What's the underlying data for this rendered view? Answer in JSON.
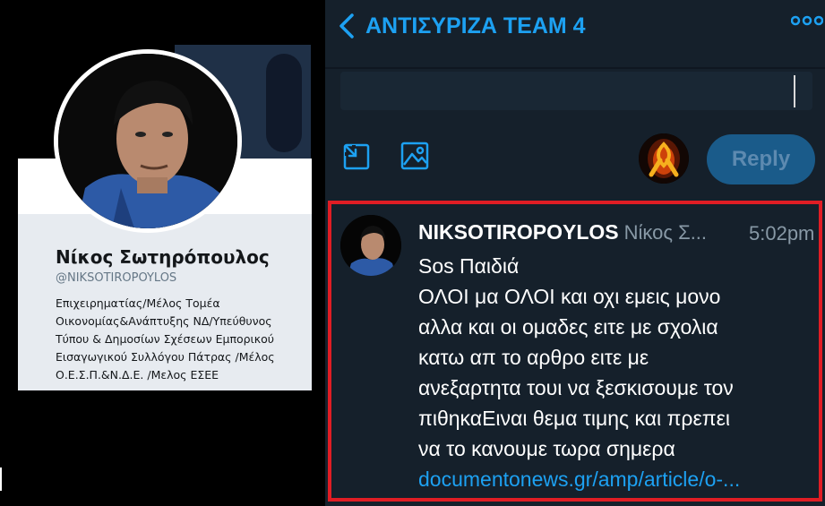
{
  "profile": {
    "name": "Νίκος Σωτηρόπουλος",
    "handle": "@NIKSOTIROPOYLOS",
    "bio_lines": [
      "Επιχειρηματίας/Μέλος Τομέα",
      "Οικονομίας&Ανάπτυξης ΝΔ/Υπεύθυνος",
      "Τύπου & Δημοσίων Σχέσεων Εμπορικού",
      "Εισαγωγικού Συλλόγου Πάτρας /Μέλος",
      "Ο.Ε.Σ.Π.&Ν.Δ.Ε. /Μελος ΕΣΕΕ"
    ]
  },
  "dm": {
    "title": "ΑΝΤΙΣΥΡΙΖΑ TEAM 4",
    "reply_label": "Reply",
    "composer_value": "",
    "colors": {
      "accent": "#1da1f2",
      "background": "#15202b",
      "highlight_border": "#e01d24"
    },
    "icons": [
      "back-chevron-icon",
      "more-options-icon",
      "gif-expand-icon",
      "image-icon"
    ]
  },
  "message": {
    "username": "NIKSOTIROPOYLOS",
    "display_name": "Νίκος Σ...",
    "time": "5:02pm",
    "lines": [
      "Sos Παιδιά",
      "ΟΛΟΙ μα ΟΛΟΙ και οχι εμεις μονο",
      "αλλα και οι ομαδες ειτε με σχολια",
      "κατω απ το αρθρο ειτε με",
      "ανεξαρτητα τουι να ξεσκισουμε τον",
      "πιθηκαΕιναι θεμα τιμης και πρεπει",
      "να το κανουμε τωρα σημερα"
    ],
    "link": "documentonews.gr/amp/article/o-..."
  }
}
